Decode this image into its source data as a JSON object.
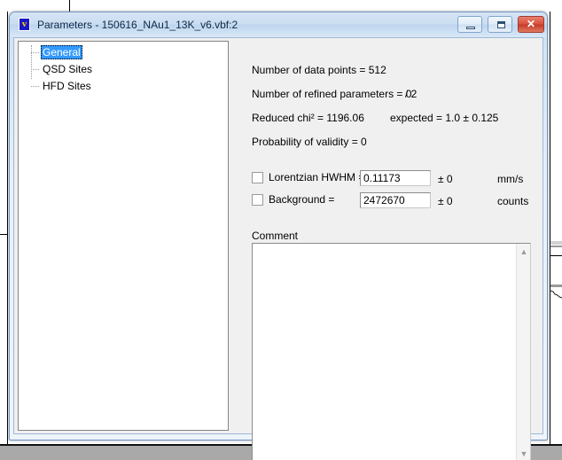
{
  "window": {
    "title": "Parameters - 150616_NAu1_13K_v6.vbf:2",
    "icon": "vbf-app-icon",
    "buttons": {
      "minimize": "minimize-icon",
      "maximize": "maximize-icon",
      "close": "✕"
    }
  },
  "tree": {
    "items": [
      {
        "label": "General",
        "selected": true
      },
      {
        "label": "QSD Sites",
        "selected": false
      },
      {
        "label": "HFD Sites",
        "selected": false
      }
    ]
  },
  "general": {
    "info": [
      {
        "text": "Number of data points = 512"
      },
      {
        "text": "Number of refined parameters = 0"
      },
      {
        "text": "/ 2"
      },
      {
        "text": "Reduced chi² = 1196.06"
      },
      {
        "text": "expected = 1.0 ± 0.125"
      },
      {
        "text": "Probability of validity =  0"
      }
    ],
    "fields": [
      {
        "checkbox_checked": false,
        "label": "Lorentzian HWHM =",
        "value": "0.11173",
        "error": "± 0",
        "unit": "mm/s"
      },
      {
        "checkbox_checked": false,
        "label": "Background =",
        "value": "2472670",
        "error": "± 0",
        "unit": "counts"
      }
    ],
    "comment": {
      "label": "Comment",
      "value": "",
      "placeholder": "",
      "scroll_up": "▲",
      "scroll_down": "▼"
    }
  },
  "colors": {
    "selection": "#3399ff",
    "titlebar": "#cbddf1",
    "close_button": "#c33a28",
    "panel": "#f0f0f0",
    "taskbar": "#a9a9a9"
  }
}
